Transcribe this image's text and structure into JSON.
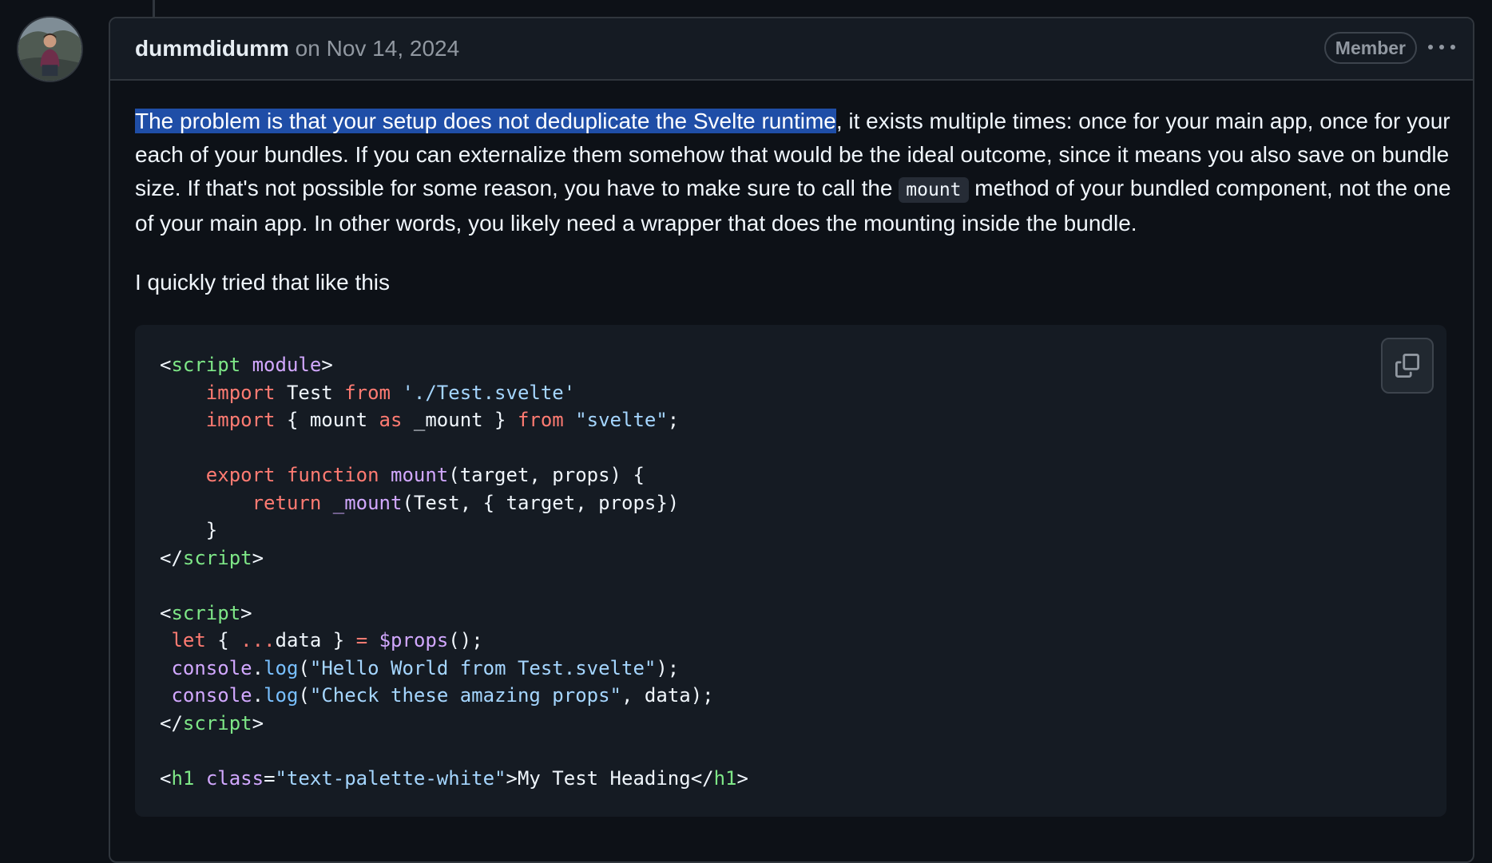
{
  "comment": {
    "author": "dummdidumm",
    "date": "on Nov 14, 2024",
    "badge": "Member",
    "paragraph1": {
      "selected": "The problem is that your setup does not deduplicate the Svelte runtime",
      "rest_a": ", it exists multiple times: once for your main app, once for your each of your bundles. If you can externalize them somehow that would be the ideal outcome, since it means you also save on bundle size. If that's not possible for some reason, you have to make sure to call the ",
      "code": "mount",
      "rest_b": " method of your bundled component, not the one of your main app. In other words, you likely need a wrapper that does the mounting inside the bundle."
    },
    "paragraph2": "I quickly tried that like this",
    "code_lines": [
      [
        [
          "p",
          "<"
        ],
        [
          "tag",
          "script"
        ],
        [
          "p",
          " "
        ],
        [
          "attr",
          "module"
        ],
        [
          "p",
          ">"
        ]
      ],
      [
        [
          "p",
          "    "
        ],
        [
          "kw",
          "import"
        ],
        [
          "p",
          " Test "
        ],
        [
          "kw",
          "from"
        ],
        [
          "p",
          " "
        ],
        [
          "str",
          "'./Test.svelte'"
        ]
      ],
      [
        [
          "p",
          "    "
        ],
        [
          "kw",
          "import"
        ],
        [
          "p",
          " { mount "
        ],
        [
          "kw",
          "as"
        ],
        [
          "p",
          " _mount } "
        ],
        [
          "kw",
          "from"
        ],
        [
          "p",
          " "
        ],
        [
          "str",
          "\"svelte\""
        ],
        [
          "p",
          ";"
        ]
      ],
      [
        [
          "p",
          ""
        ]
      ],
      [
        [
          "p",
          "    "
        ],
        [
          "kw",
          "export"
        ],
        [
          "p",
          " "
        ],
        [
          "kw",
          "function"
        ],
        [
          "p",
          " "
        ],
        [
          "fn",
          "mount"
        ],
        [
          "p",
          "(target, props) {"
        ]
      ],
      [
        [
          "p",
          "        "
        ],
        [
          "kw",
          "return"
        ],
        [
          "p",
          " "
        ],
        [
          "fn",
          "_mount"
        ],
        [
          "p",
          "(Test, { target, props})"
        ]
      ],
      [
        [
          "p",
          "    }"
        ]
      ],
      [
        [
          "p",
          "</"
        ],
        [
          "tag",
          "script"
        ],
        [
          "p",
          ">"
        ]
      ],
      [
        [
          "p",
          ""
        ]
      ],
      [
        [
          "p",
          "<"
        ],
        [
          "tag",
          "script"
        ],
        [
          "p",
          ">"
        ]
      ],
      [
        [
          "p",
          " "
        ],
        [
          "kw",
          "let"
        ],
        [
          "p",
          " { "
        ],
        [
          "kw",
          "..."
        ],
        [
          "p",
          "data } "
        ],
        [
          "kw",
          "="
        ],
        [
          "p",
          " "
        ],
        [
          "fn",
          "$props"
        ],
        [
          "p",
          "();"
        ]
      ],
      [
        [
          "p",
          " "
        ],
        [
          "fn",
          "console"
        ],
        [
          "p",
          "."
        ],
        [
          "prop",
          "log"
        ],
        [
          "p",
          "("
        ],
        [
          "str",
          "\"Hello World from Test.svelte\""
        ],
        [
          "p",
          ");"
        ]
      ],
      [
        [
          "p",
          " "
        ],
        [
          "fn",
          "console"
        ],
        [
          "p",
          "."
        ],
        [
          "prop",
          "log"
        ],
        [
          "p",
          "("
        ],
        [
          "str",
          "\"Check these amazing props\""
        ],
        [
          "p",
          ", data);"
        ]
      ],
      [
        [
          "p",
          "</"
        ],
        [
          "tag",
          "script"
        ],
        [
          "p",
          ">"
        ]
      ],
      [
        [
          "p",
          ""
        ]
      ],
      [
        [
          "p",
          "<"
        ],
        [
          "tag",
          "h1"
        ],
        [
          "p",
          " "
        ],
        [
          "attr",
          "class"
        ],
        [
          "p",
          "="
        ],
        [
          "str",
          "\"text-palette-white\""
        ],
        [
          "p",
          ">My Test Heading</"
        ],
        [
          "tag",
          "h1"
        ],
        [
          "p",
          ">"
        ]
      ]
    ],
    "icons": {
      "avatar": "avatar-photo",
      "more": "kebab-horizontal-icon",
      "copy": "copy-icon"
    }
  }
}
